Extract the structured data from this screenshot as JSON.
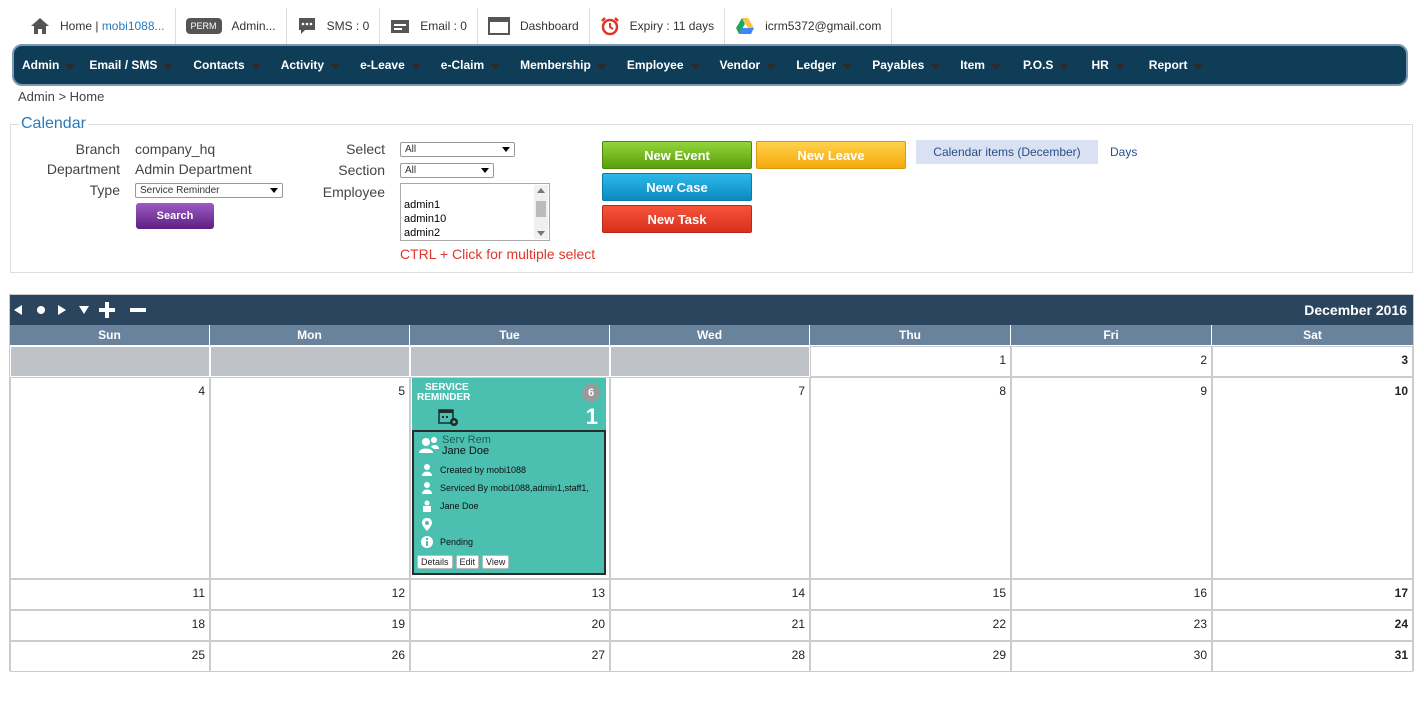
{
  "topbar": {
    "home_label": "Home |",
    "home_user": "mobi1088...",
    "perm_badge": "PERM",
    "admin_label": "Admin...",
    "sms_label": "SMS : 0",
    "email_label": "Email : 0",
    "dashboard_label": "Dashboard",
    "expiry_label": "Expiry : 11 days",
    "account_email": "icrm5372@gmail.com"
  },
  "nav": {
    "items": [
      "Admin",
      "Email / SMS",
      "Contacts",
      "Activity",
      "e-Leave",
      "e-Claim",
      "Membership",
      "Employee",
      "Vendor",
      "Ledger",
      "Payables",
      "Item",
      "P.O.S",
      "HR",
      "Report"
    ]
  },
  "breadcrumb": "Admin > Home",
  "filters": {
    "legend": "Calendar",
    "branch_label": "Branch",
    "branch_value": "company_hq",
    "department_label": "Department",
    "department_value": "Admin Department",
    "type_label": "Type",
    "type_value": "Service Reminder",
    "search_label": "Search",
    "select_label": "Select",
    "select_value": "All",
    "section_label": "Section",
    "section_value": "All",
    "employee_label": "Employee",
    "employee_options": [
      "admin1",
      "admin10",
      "admin2"
    ],
    "hint": "CTRL + Click for multiple select"
  },
  "actions": {
    "new_event": "New Event",
    "new_leave": "New Leave",
    "new_case": "New Case",
    "new_task": "New Task",
    "calendar_items": "Calendar items (December)",
    "days": "Days"
  },
  "calendar": {
    "title": "December 2016",
    "weekdays": [
      "Sun",
      "Mon",
      "Tue",
      "Wed",
      "Thu",
      "Fri",
      "Sat"
    ],
    "weeks": [
      [
        "",
        "",
        "",
        "",
        "1",
        "2",
        "3"
      ],
      [
        "4",
        "5",
        "",
        "7",
        "8",
        "9",
        "10"
      ],
      [
        "11",
        "12",
        "13",
        "14",
        "15",
        "16",
        "17"
      ],
      [
        "18",
        "19",
        "20",
        "21",
        "22",
        "23",
        "24"
      ],
      [
        "25",
        "26",
        "27",
        "28",
        "29",
        "30",
        "31"
      ]
    ]
  },
  "event": {
    "title_line1": "SERVICE",
    "title_line2": "REMINDER",
    "badge": "6",
    "count": "1",
    "type": "Serv Rem",
    "name": "Jane Doe",
    "created_by": "Created by mobi1088",
    "serviced_by": "Serviced By mobi1088,admin1,staff1,",
    "contact": "Jane Doe",
    "location": "",
    "status": "Pending",
    "buttons": [
      "Details",
      "Edit",
      "View"
    ]
  },
  "colors": {
    "nav_bg": "#0f3d58",
    "calendar_header": "#2c455e",
    "weekday_header": "#6a839d",
    "event_teal": "#4bbfb0",
    "accent_blue": "#2a7ab8",
    "hint_red": "#e0352b"
  }
}
